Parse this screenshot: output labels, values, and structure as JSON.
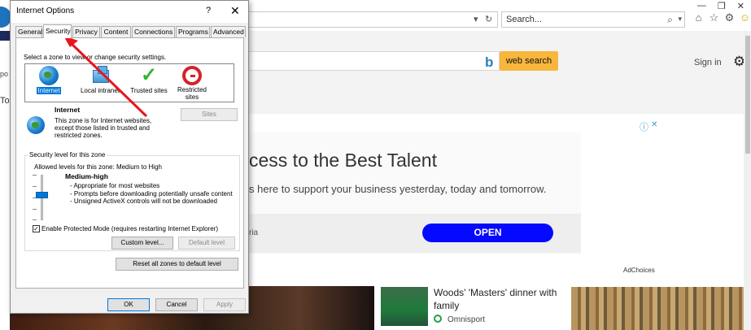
{
  "dialog": {
    "title": "Internet Options",
    "help_glyph": "?",
    "close_glyph": "✕",
    "tabs": [
      {
        "label": "General"
      },
      {
        "label": "Security"
      },
      {
        "label": "Privacy"
      },
      {
        "label": "Content"
      },
      {
        "label": "Connections"
      },
      {
        "label": "Programs"
      },
      {
        "label": "Advanced"
      }
    ],
    "active_tab": "Security",
    "zone_prompt": "Select a zone to view or change security settings.",
    "zones": [
      {
        "label": "Internet",
        "icon": "globe-icon",
        "selected": true
      },
      {
        "label": "Local intranet",
        "icon": "intranet-icon",
        "selected": false
      },
      {
        "label": "Trusted sites",
        "icon": "checkmark-icon",
        "selected": false
      },
      {
        "label": "Restricted sites",
        "icon": "no-entry-icon",
        "selected": false
      }
    ],
    "zone_info": {
      "name": "Internet",
      "description": "This zone is for Internet websites, except those listed in trusted and restricted zones."
    },
    "sites_button": "Sites",
    "security_group_label": "Security level for this zone",
    "allowed_levels": "Allowed levels for this zone: Medium to High",
    "level": {
      "name": "Medium-high",
      "items": [
        "- Appropriate for most websites",
        "- Prompts before downloading potentially unsafe content",
        "- Unsigned ActiveX controls will not be downloaded"
      ]
    },
    "protected_mode": {
      "label": "Enable Protected Mode (requires restarting Internet Explorer)",
      "checked": true,
      "check_glyph": "✓"
    },
    "custom_level_button": "Custom level...",
    "default_level_button": "Default level",
    "reset_button": "Reset all zones to default level",
    "ok_button": "OK",
    "cancel_button": "Cancel",
    "apply_button": "Apply"
  },
  "browser": {
    "search_placeholder": "Search...",
    "search_icon": "⌕",
    "dropdown_glyph": "▾",
    "refresh_glyph": "↻",
    "window_controls": [
      "—",
      "❐",
      "✕"
    ],
    "toolbar_icons": [
      "⌂",
      "☆",
      "⚙",
      "☺"
    ],
    "web_search_button": "web search",
    "sign_in": "Sign in",
    "gear_glyph": "⚙",
    "bing_glyph": "b",
    "left_cut_text": "po",
    "left_cut_tab": "To",
    "ad": {
      "headline": "cess to the Best Talent",
      "subtext": "s here to support your business yesterday, today and tomorrow.",
      "source": "ria",
      "open_button": "OPEN",
      "info_glyph": "ⓘ",
      "close_glyph": "✕",
      "adchoices": "AdChoices"
    },
    "news": {
      "title": "Woods' 'Masters' dinner with family",
      "source": "Omnisport"
    }
  },
  "colors": {
    "accent": "#0078d7",
    "annotation_arrow": "#e8141c",
    "web_search": "#f8b63c",
    "ad_button": "#0509ff"
  }
}
